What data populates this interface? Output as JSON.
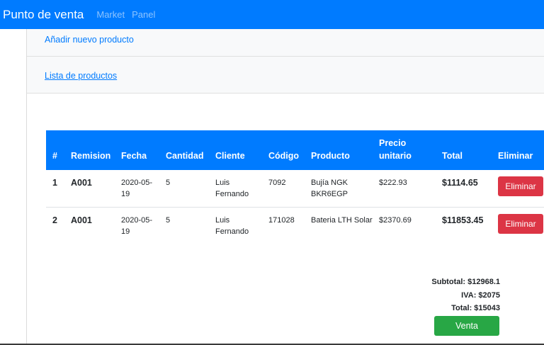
{
  "navbar": {
    "brand": "Punto de venta",
    "links": [
      "Market",
      "Panel"
    ],
    "bg_color": "#007bff"
  },
  "menu": {
    "add_product": "Añadir nuevo producto",
    "product_list": "Lista de productos"
  },
  "table": {
    "headers": [
      "#",
      "Remision",
      "Fecha",
      "Cantidad",
      "Cliente",
      "Código",
      "Producto",
      "Precio unitario",
      "Total",
      "Eliminar"
    ],
    "rows": [
      {
        "num": "1",
        "remision": "A001",
        "fecha": "2020-05-19",
        "cantidad": "5",
        "cliente": "Luis Fernando",
        "codigo": "7092",
        "producto": "Bujía NGK BKR6EGP",
        "precio": "$222.93",
        "total": "$1114.65",
        "action": "Eliminar"
      },
      {
        "num": "2",
        "remision": "A001",
        "fecha": "2020-05-19",
        "cantidad": "5",
        "cliente": "Luis Fernando",
        "codigo": "171028",
        "producto": "Bateria LTH Solar",
        "precio": "$2370.69",
        "total": "$11853.45",
        "action": "Eliminar"
      }
    ]
  },
  "summary": {
    "subtotal": "Subtotal: $12968.1",
    "iva": "IVA: $2075",
    "total": "Total: $15043",
    "sale_button": "Venta"
  },
  "colors": {
    "primary": "#007bff",
    "danger": "#dc3545",
    "success": "#28a745"
  }
}
